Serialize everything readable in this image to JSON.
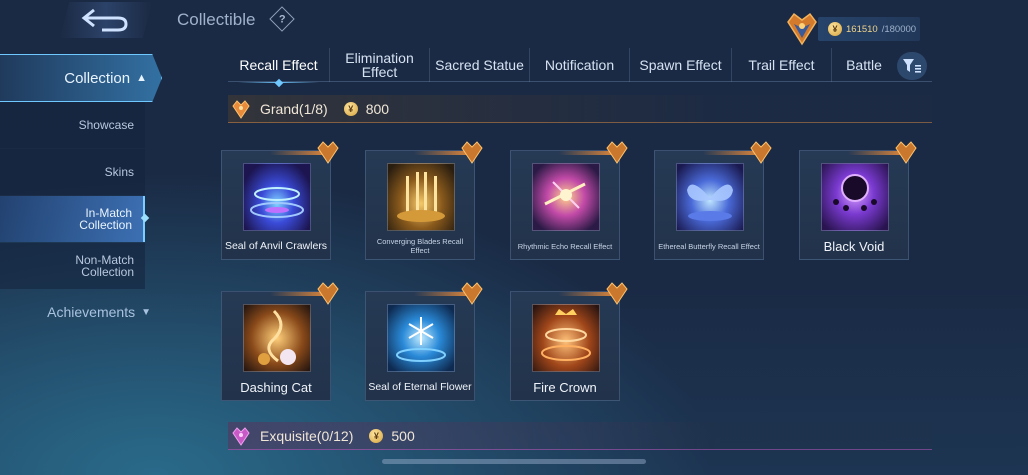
{
  "header": {
    "title": "Collectible",
    "help_symbol": "?",
    "points_current": "161510",
    "points_max": "/180000",
    "coin_symbol": "¥"
  },
  "sidebar": {
    "collection_label": "Collection",
    "items": [
      {
        "label": "Showcase"
      },
      {
        "label": "Skins"
      },
      {
        "label": "In-Match Collection",
        "active": true
      },
      {
        "label": "Non-Match Collection"
      }
    ],
    "achievements_label": "Achievements"
  },
  "tabs": [
    {
      "label": "Recall Effect",
      "active": true
    },
    {
      "label": "Elimination Effect"
    },
    {
      "label": "Sacred Statue"
    },
    {
      "label": "Notification"
    },
    {
      "label": "Spawn Effect"
    },
    {
      "label": "Trail Effect"
    },
    {
      "label": "Battle"
    }
  ],
  "sections": {
    "grand": {
      "name": "Grand(1/8)",
      "cost": "800",
      "items": [
        {
          "name": "Seal of Anvil Crawlers"
        },
        {
          "name": "Converging Blades Recall Effect"
        },
        {
          "name": "Rhythmic Echo Recall Effect"
        },
        {
          "name": "Ethereal Butterfly Recall Effect"
        },
        {
          "name": "Black Void"
        },
        {
          "name": "Dashing Cat"
        },
        {
          "name": "Seal of Eternal Flower"
        },
        {
          "name": "Fire Crown"
        }
      ]
    },
    "exquisite": {
      "name": "Exquisite(0/12)",
      "cost": "500"
    }
  },
  "colors": {
    "accent": "#6fc8ff",
    "grand_orange": "#e88b3a",
    "exquisite_purple": "#c85ac8",
    "gold": "#f0d38a"
  }
}
